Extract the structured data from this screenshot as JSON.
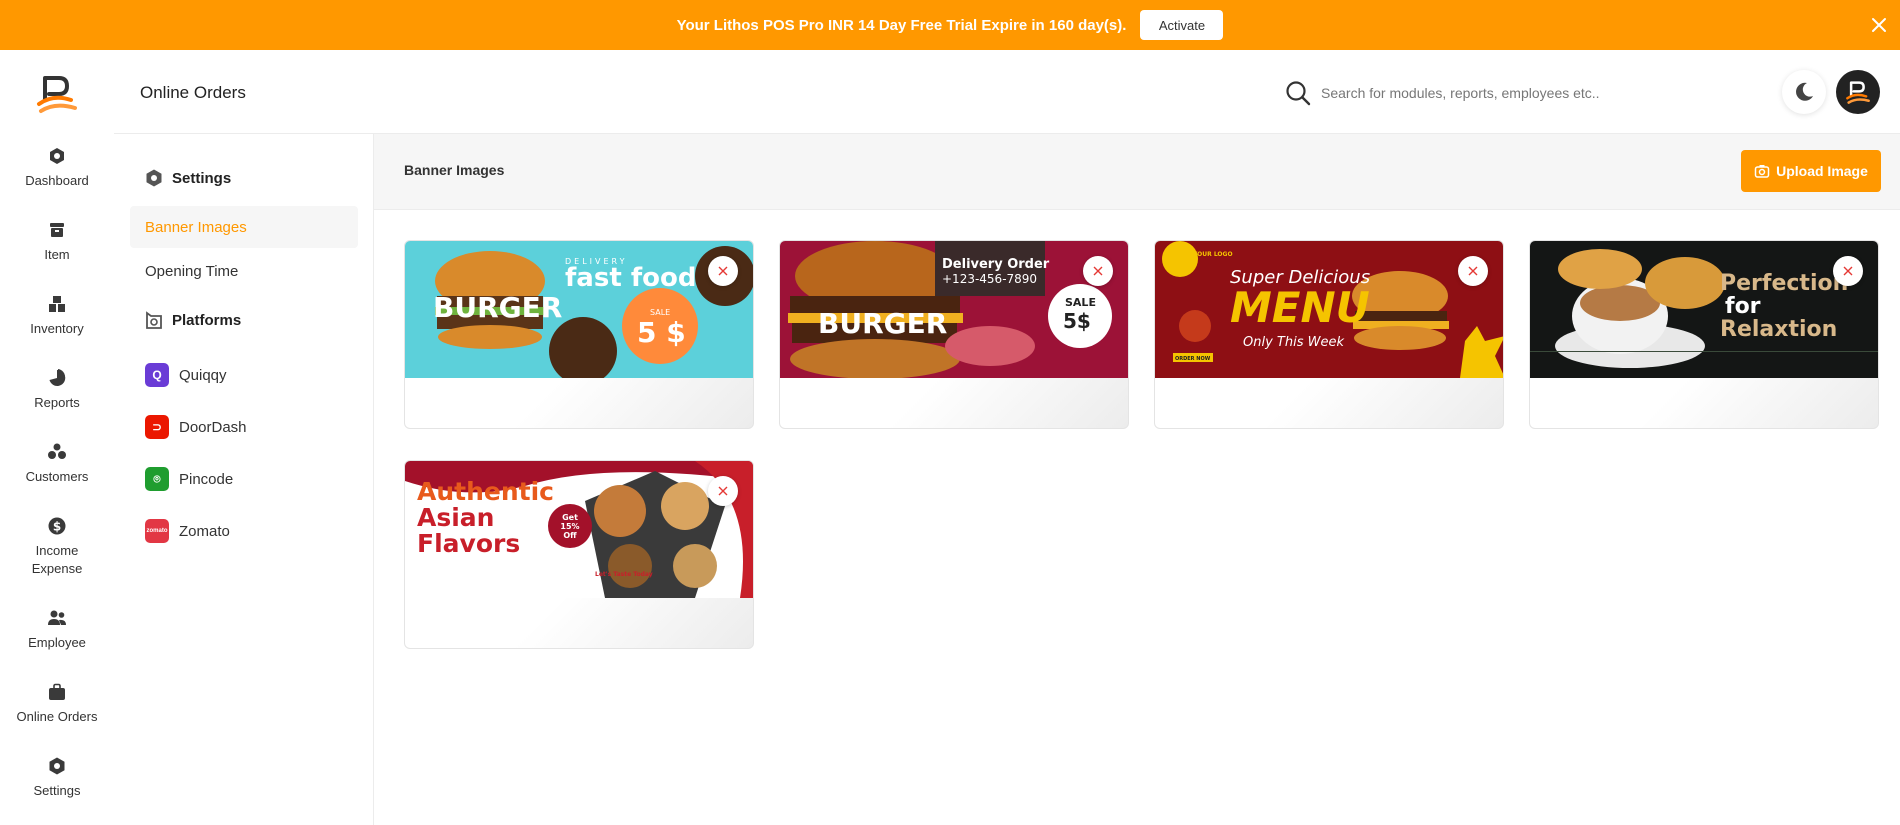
{
  "trial_bar": {
    "message": "Your Lithos POS Pro INR 14 Day Free Trial Expire in 160 day(s).",
    "activate_label": "Activate",
    "color": "#ff9800"
  },
  "rail": {
    "items": [
      {
        "label": "Dashboard",
        "icon": "dashboard-icon"
      },
      {
        "label": "Item",
        "icon": "item-icon"
      },
      {
        "label": "Inventory",
        "icon": "inventory-icon"
      },
      {
        "label": "Reports",
        "icon": "reports-icon"
      },
      {
        "label": "Customers",
        "icon": "customers-icon"
      },
      {
        "label": "Income\nExpense",
        "icon": "income-expense-icon"
      },
      {
        "label": "Employee",
        "icon": "employee-icon"
      },
      {
        "label": "Online Orders",
        "icon": "online-orders-icon"
      },
      {
        "label": "Settings",
        "icon": "settings-icon"
      }
    ]
  },
  "header": {
    "title": "Online Orders",
    "search_placeholder": "Search for modules, reports, employees etc.."
  },
  "settings_nav": {
    "settings_heading": "Settings",
    "banner_images": "Banner Images",
    "opening_time": "Opening Time",
    "platforms_heading": "Platforms",
    "platforms": [
      {
        "label": "Quiqqy",
        "color": "#6a3cd6"
      },
      {
        "label": "DoorDash",
        "color": "#eb1700"
      },
      {
        "label": "Pincode",
        "color": "#1f9d2f"
      },
      {
        "label": "Zomato",
        "color": "#e23744"
      }
    ]
  },
  "main": {
    "section_title": "Banner Images",
    "upload_label": "Upload Image",
    "banners": [
      {
        "b1": "DELIVERY",
        "b2": "fast food",
        "b3": "BURGER",
        "b4": "SALE",
        "b5": "5 $"
      },
      {
        "b1": "Delivery Order",
        "b2": "+123-456-7890",
        "b3": "BURGER",
        "b4": "SALE",
        "b5": "5$"
      },
      {
        "b1": "ORDER NOW",
        "b2": "Super Delicious",
        "b3": "MENU",
        "b4": "Only This Week",
        "b5": "YOUR LOGO"
      },
      {
        "b1": "Perfection",
        "b2": "for",
        "b3": "Relaxtion"
      },
      {
        "b1": "Authentic",
        "b2": "Asian",
        "b3": "Flavors",
        "b4": "Get 15% Off",
        "b5": "Let's Taste Today"
      }
    ]
  }
}
